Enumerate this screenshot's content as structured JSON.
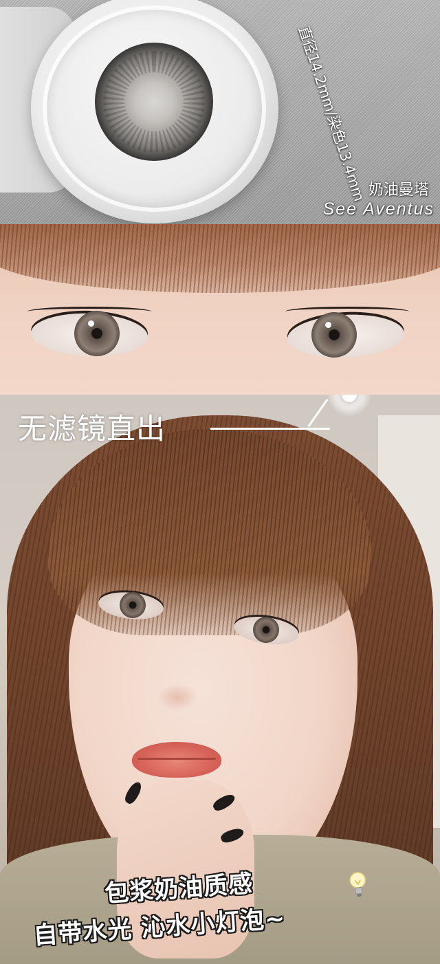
{
  "lens_panel": {
    "spec_text": "直径14.2mm/染色13.4mm",
    "product_name_cn": "奶油曼塔",
    "product_name_en": "See Aventus"
  },
  "selfie_panel": {
    "no_filter_label": "无滤镜直出",
    "caption_line1": "包浆奶油质感",
    "caption_line2": "自带水光 沁水小灯泡~"
  }
}
